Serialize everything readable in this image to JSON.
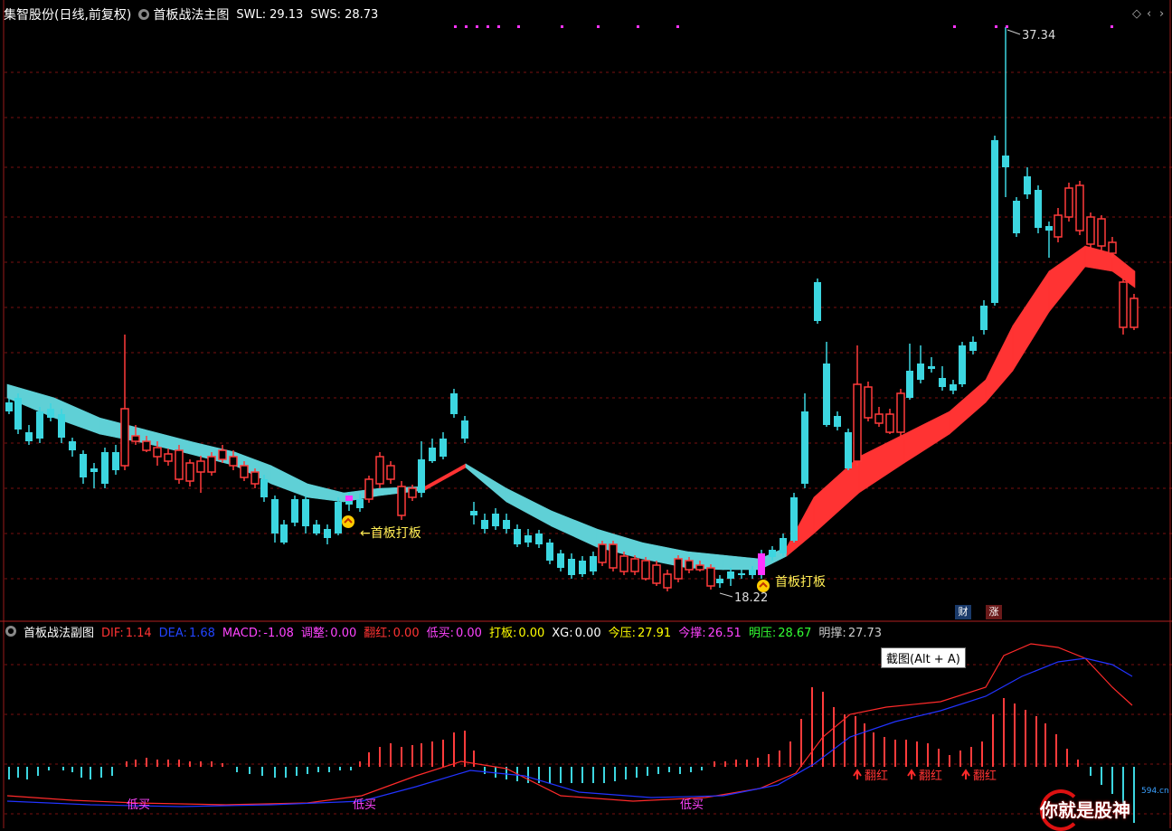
{
  "header": {
    "stock_title": "集智股份(日线,前复权)",
    "indicator_name": "首板战法主图",
    "swl_label": "SWL:",
    "swl_value": "29.13",
    "sws_label": "SWS:",
    "sws_value": "28.73"
  },
  "controls": {
    "prev": "◇",
    "next": "‹",
    "close": "›"
  },
  "main_chart": {
    "high_label": "37.34",
    "low_label": "18.22",
    "signal_labels": [
      "←首板打板",
      "首板打板"
    ],
    "badges": [
      {
        "text": "财",
        "color": "#1a3a6a"
      },
      {
        "text": "涨",
        "color": "#6a1a1a"
      }
    ]
  },
  "sub_chart": {
    "indicator_name": "首板战法副图",
    "fields": [
      {
        "label": "DIF:",
        "value": "1.14",
        "color": "#ff3333"
      },
      {
        "label": "DEA:",
        "value": "1.68",
        "color": "#2244ff"
      },
      {
        "label": "MACD:",
        "value": "-1.08",
        "color": "#ff44ff"
      },
      {
        "label": "调整:",
        "value": "0.00",
        "color": "#ff44ff"
      },
      {
        "label": "翻红:",
        "value": "0.00",
        "color": "#ff3333"
      },
      {
        "label": "低买:",
        "value": "0.00",
        "color": "#ff44ff"
      },
      {
        "label": "打板:",
        "value": "0.00",
        "color": "#ffff00"
      },
      {
        "label": "XG:",
        "value": "0.00",
        "color": "#ffffff"
      },
      {
        "label": "今压:",
        "value": "27.91",
        "color": "#ffff00"
      },
      {
        "label": "今撑:",
        "value": "26.51",
        "color": "#ff44ff"
      },
      {
        "label": "明压:",
        "value": "28.67",
        "color": "#33ff33"
      },
      {
        "label": "明撑:",
        "value": "27.73",
        "color": "#cccccc"
      }
    ],
    "buy_labels": [
      "低买",
      "低买",
      "低买"
    ],
    "red_labels": [
      "翻红",
      "翻红",
      "翻红"
    ]
  },
  "tooltip": "截图(Alt + A)",
  "watermark": {
    "text": "你就是股神",
    "site": "594.cn"
  },
  "colors": {
    "up": "#ff3b3b",
    "down": "#3cd6e0",
    "band_down": "#5fd0d6",
    "band_up": "#ff3333",
    "grid": "#7a1010"
  }
}
